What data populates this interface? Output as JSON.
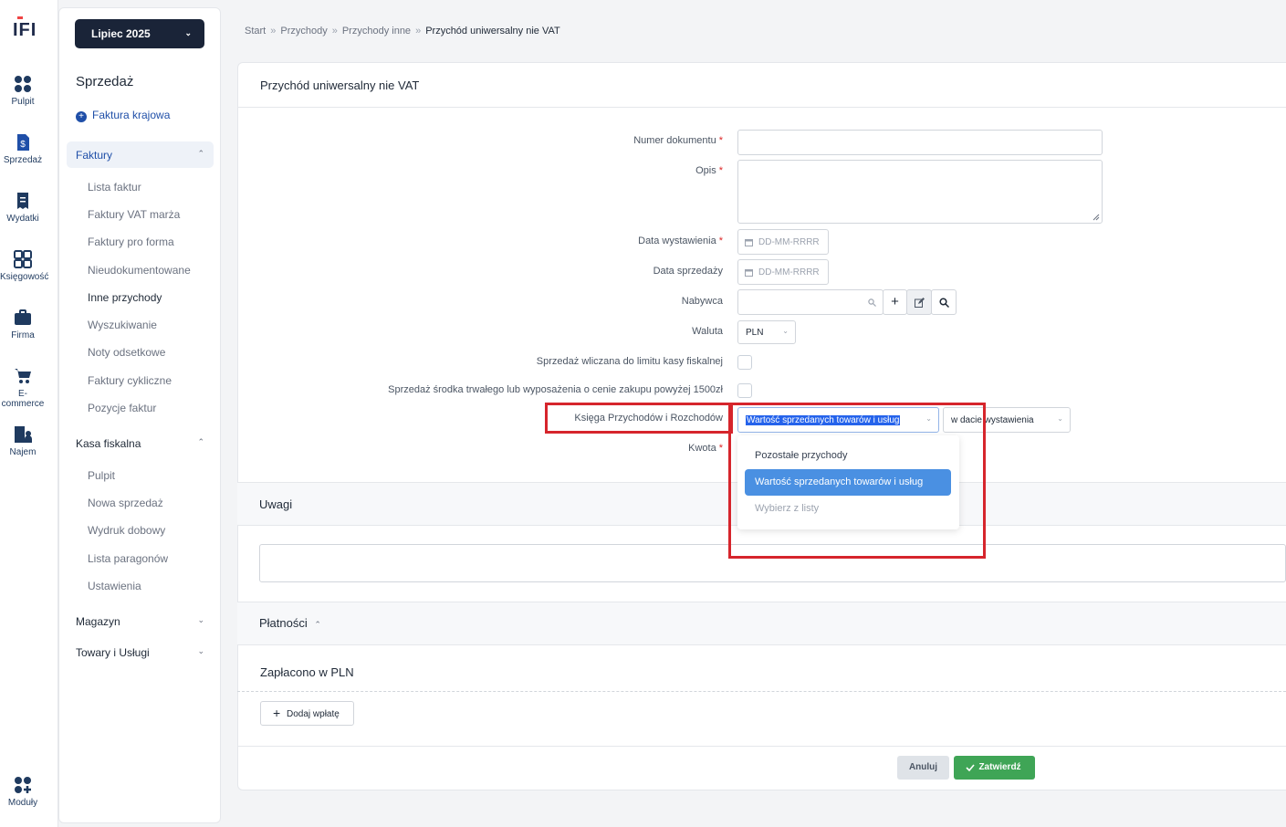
{
  "logo": {
    "text": "IFI"
  },
  "rail": [
    {
      "label": "Pulpit",
      "icon": "dashboard-icon"
    },
    {
      "label": "Sprzedaż",
      "icon": "invoice-icon"
    },
    {
      "label": "Wydatki",
      "icon": "receipt-icon"
    },
    {
      "label": "Księgowość",
      "icon": "accounting-icon"
    },
    {
      "label": "Firma",
      "icon": "briefcase-icon"
    },
    {
      "label": "E-commerce",
      "icon": "cart-icon"
    },
    {
      "label": "Najem",
      "icon": "building-icon"
    },
    {
      "label": "Moduły",
      "icon": "modules-icon"
    }
  ],
  "sidebar": {
    "period": "Lipiec 2025",
    "title": "Sprzedaż",
    "add_label": "Faktura krajowa",
    "groups": {
      "faktury": "Faktury",
      "kasa": "Kasa fiskalna",
      "magazyn": "Magazyn",
      "towary": "Towary i Usługi"
    },
    "faktury_items": [
      "Lista faktur",
      "Faktury VAT marża",
      "Faktury pro forma",
      "Nieudokumentowane",
      "Inne przychody",
      "Wyszukiwanie",
      "Noty odsetkowe",
      "Faktury cykliczne",
      "Pozycje faktur"
    ],
    "kasa_items": [
      "Pulpit",
      "Nowa sprzedaż",
      "Wydruk dobowy",
      "Lista paragonów",
      "Ustawienia"
    ]
  },
  "breadcrumb": [
    "Start",
    "Przychody",
    "Przychody inne",
    "Przychód uniwersalny nie VAT"
  ],
  "form": {
    "title": "Przychód uniwersalny nie VAT",
    "numer_label": "Numer dokumentu",
    "opis_label": "Opis",
    "data_wyst_label": "Data wystawienia",
    "data_wyst_placeholder": "DD-MM-RRRR",
    "data_sprz_label": "Data sprzedaży",
    "data_sprz_placeholder": "DD-MM-RRRR",
    "nabywca_label": "Nabywca",
    "waluta_label": "Waluta",
    "waluta_value": "PLN",
    "kasa_label": "Sprzedaż wliczana do limitu kasy fiskalnej",
    "srodek_label": "Sprzedaż środka trwałego lub wyposażenia o cenie zakupu powyżej 1500zł",
    "kpir_label": "Księga Przychodów i Rozchodów",
    "kpir_value": "Wartość sprzedanych towarów i usług",
    "kpir_date_value": "w dacie wystawienia",
    "kwota_label": "Kwota"
  },
  "dropdown": {
    "options": [
      "Pozostałe przychody",
      "Wartość sprzedanych towarów i usług",
      "Wybierz z listy"
    ],
    "selected_index": 1
  },
  "uwagi": {
    "title": "Uwagi"
  },
  "platnosci": {
    "title": "Płatności",
    "paid_title": "Zapłacono w PLN",
    "add_payment": "Dodaj wpłatę"
  },
  "actions": {
    "cancel": "Anuluj",
    "confirm": "Zatwierdź"
  },
  "colors": {
    "highlight": "#d6252c",
    "accent": "#1f4fa8",
    "success": "#3fa556"
  }
}
